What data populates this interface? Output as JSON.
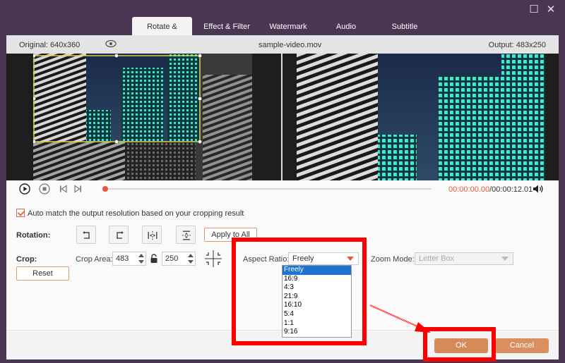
{
  "window": {
    "maximize_glyph": "☐",
    "close_glyph": "✕"
  },
  "tabs": [
    {
      "label": "Rotate & Crop",
      "active": true
    },
    {
      "label": "Effect & Filter",
      "active": false
    },
    {
      "label": "Watermark",
      "active": false
    },
    {
      "label": "Audio",
      "active": false
    },
    {
      "label": "Subtitle",
      "active": false
    }
  ],
  "info": {
    "original": "Original: 640x360",
    "filename": "sample-video.mov",
    "output": "Output: 483x250"
  },
  "playback": {
    "current_time": "00:00:00.00",
    "total_time": "/00:00:12.01",
    "progress": 0.0
  },
  "settings": {
    "auto_match_label": "Auto match the output resolution based on your cropping result",
    "auto_match_checked": true,
    "rotation_label": "Rotation:",
    "apply_all_label": "Apply to All",
    "crop_label": "Crop:",
    "crop_area_label": "Crop Area:",
    "crop_width": "483",
    "crop_height": "250",
    "reset_label": "Reset",
    "aspect_ratio_label": "Aspect Ratio:",
    "aspect_ratio_value": "Freely",
    "aspect_ratio_options": [
      "Freely",
      "16:9",
      "4:3",
      "21:9",
      "16:10",
      "5:4",
      "1:1",
      "9:16"
    ],
    "zoom_mode_label": "Zoom Mode:",
    "zoom_mode_value": "Letter Box"
  },
  "footer": {
    "ok_label": "OK",
    "cancel_label": "Cancel"
  },
  "colors": {
    "accent": "#e8553e",
    "ok_button": "#d58a5a",
    "cancel_button": "#d9905e",
    "highlight": "#ff0000",
    "selected_option": "#1f73d0"
  }
}
